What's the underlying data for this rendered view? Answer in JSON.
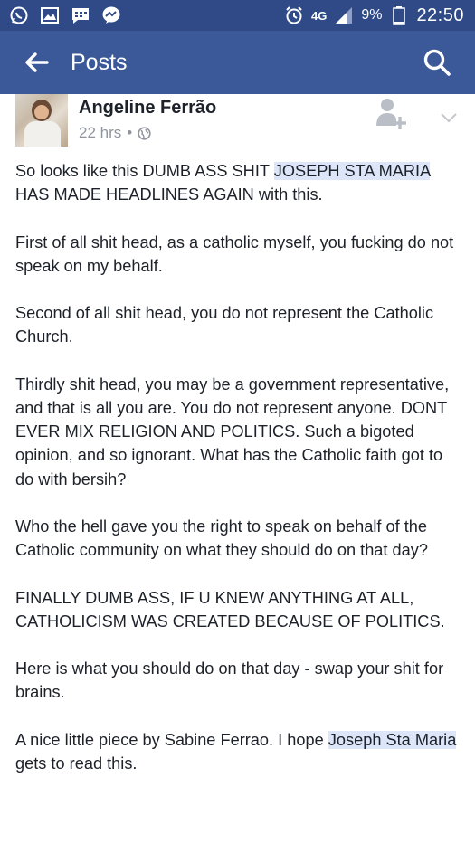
{
  "status_bar": {
    "network": "4G",
    "battery": "9%",
    "time": "22:50"
  },
  "app_bar": {
    "title": "Posts"
  },
  "post": {
    "author": "Angeline Ferrão",
    "time": "22 hrs",
    "separator": "•",
    "paragraphs": [
      {
        "before": "So looks like this DUMB ASS SHIT ",
        "mention": "JOSEPH STA MARIA",
        "after": " HAS MADE HEADLINES AGAIN with this."
      },
      {
        "text": "First of all shit head,  as a catholic myself, you fucking do not speak on my behalf."
      },
      {
        "text": "Second of all shit head, you do not represent the Catholic Church."
      },
      {
        "text": "Thirdly shit head, you may be a government representative, and that is all you are. You do not represent anyone.  DONT EVER MIX RELIGION AND POLITICS.  Such a bigoted opinion, and so ignorant. What has the Catholic faith got to do with bersih?"
      },
      {
        "text": "Who the hell gave you the right to speak on behalf of the Catholic community on what they should do on that day?"
      },
      {
        "text": "FINALLY DUMB ASS, IF U KNEW ANYTHING AT ALL, CATHOLICISM WAS CREATED BECAUSE OF POLITICS."
      },
      {
        "text": "Here is what you should do on that day - swap your shit for brains."
      },
      {
        "before": "A nice little piece by Sabine Ferrao.  I hope ",
        "mention": "Joseph Sta Maria",
        "after": " gets to read this."
      }
    ]
  },
  "colors": {
    "status_bar": "#2f4a86",
    "app_bar": "#3b5998",
    "mention_highlight": "#dce6f8",
    "meta_text": "#90949c"
  },
  "icons": [
    "whatsapp-icon",
    "gallery-icon",
    "message-icon",
    "messenger-icon",
    "alarm-icon",
    "signal-icon",
    "battery-icon",
    "back-arrow-icon",
    "search-icon",
    "globe-icon",
    "add-friend-icon",
    "chevron-down-icon"
  ]
}
